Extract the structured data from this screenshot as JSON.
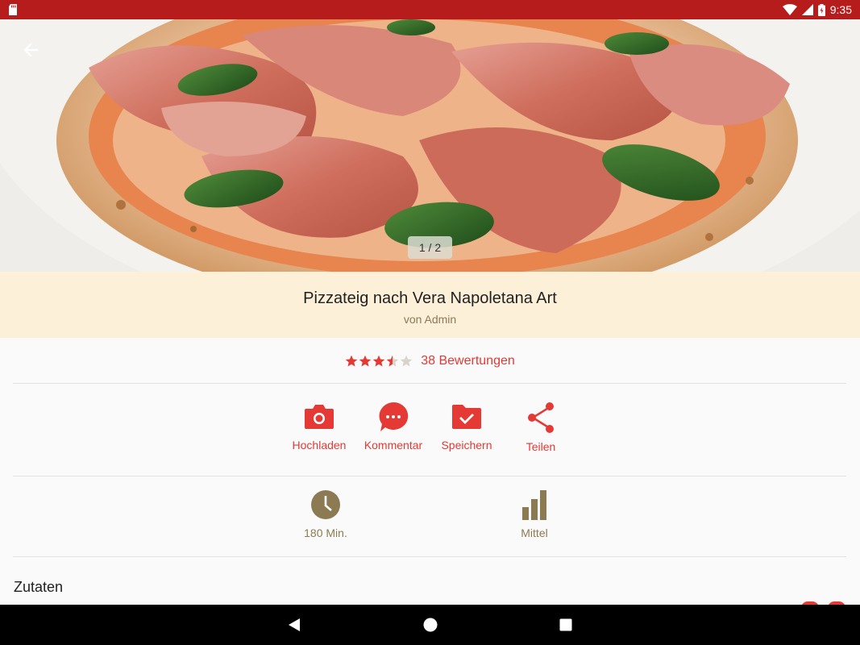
{
  "status_bar": {
    "time": "9:35"
  },
  "hero": {
    "pager": "1 / 2"
  },
  "recipe": {
    "title": "Pizzateig nach Vera Napoletana Art",
    "author": "von Admin",
    "rating": 3.5,
    "rating_max": 5,
    "rating_count_label": "38 Bewertungen"
  },
  "actions": [
    {
      "label": "Hochladen",
      "icon": "camera-icon"
    },
    {
      "label": "Kommentar",
      "icon": "comment-icon"
    },
    {
      "label": "Speichern",
      "icon": "folder-check-icon"
    },
    {
      "label": "Teilen",
      "icon": "share-icon"
    }
  ],
  "meta": {
    "time_label": "180 Min.",
    "difficulty_label": "Mittel"
  },
  "sections": {
    "ingredients_title": "Zutaten"
  },
  "colors": {
    "status_bar": "#b71c1c",
    "accent": "#e53935",
    "title_bg": "#fdf0d8",
    "meta_icon": "#8c7b52"
  }
}
